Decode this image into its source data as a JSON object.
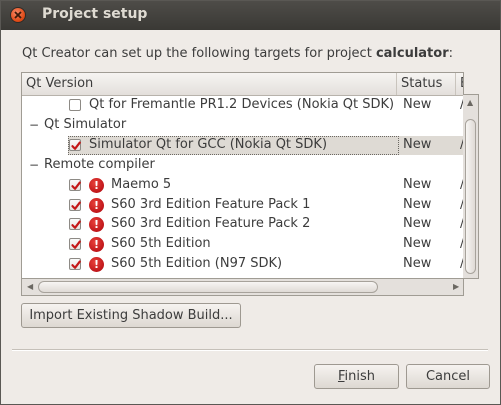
{
  "window": {
    "title": "Project setup"
  },
  "intro": {
    "prefix": "Qt Creator can set up the following targets for project ",
    "project": "calculator",
    "suffix": ":"
  },
  "tree": {
    "columns": [
      "Qt Version",
      "Status",
      "B"
    ],
    "rows": [
      {
        "type": "item",
        "label": "Qt for Fremantle PR1.2 Devices (Nokia Qt SDK)",
        "status": "New",
        "extra": "/",
        "checked": false,
        "warning": false
      },
      {
        "type": "group",
        "label": "Qt Simulator",
        "expander": "−"
      },
      {
        "type": "item",
        "label": "Simulator Qt for GCC (Nokia Qt SDK)",
        "status": "New",
        "extra": "/",
        "checked": true,
        "warning": false,
        "selected": true
      },
      {
        "type": "group",
        "label": "Remote compiler",
        "expander": "−"
      },
      {
        "type": "item",
        "label": "Maemo 5",
        "status": "New",
        "extra": "/",
        "checked": true,
        "warning": true
      },
      {
        "type": "item",
        "label": "S60 3rd Edition Feature Pack 1",
        "status": "New",
        "extra": "/",
        "checked": true,
        "warning": true
      },
      {
        "type": "item",
        "label": "S60 3rd Edition Feature Pack 2",
        "status": "New",
        "extra": "/",
        "checked": true,
        "warning": true
      },
      {
        "type": "item",
        "label": "S60 5th Edition",
        "status": "New",
        "extra": "/",
        "checked": true,
        "warning": true
      },
      {
        "type": "item",
        "label": "S60 5th Edition (N97 SDK)",
        "status": "New",
        "extra": "/",
        "checked": true,
        "warning": true
      }
    ]
  },
  "buttons": {
    "import": "Import Existing Shadow Build...",
    "finish": "Finish",
    "cancel": "Cancel"
  },
  "colors": {
    "titlebar": "#3c3b37",
    "close": "#df4a16",
    "warning": "#c0161a",
    "checkmark": "#c41818"
  }
}
